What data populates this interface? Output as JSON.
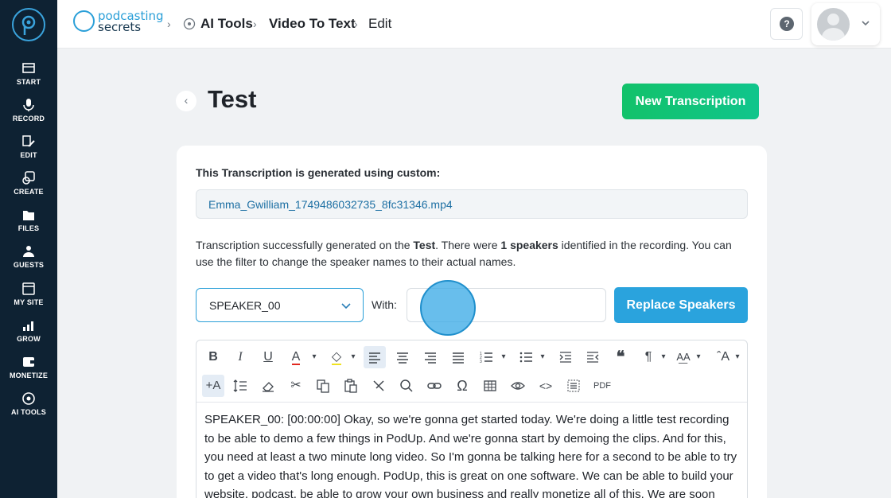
{
  "sidebar": {
    "items": [
      {
        "label": "START",
        "icon": "start-icon"
      },
      {
        "label": "RECORD",
        "icon": "microphone-icon"
      },
      {
        "label": "EDIT",
        "icon": "edit-icon"
      },
      {
        "label": "CREATE",
        "icon": "create-icon"
      },
      {
        "label": "FILES",
        "icon": "files-icon"
      },
      {
        "label": "GUESTS",
        "icon": "guests-icon"
      },
      {
        "label": "MY SITE",
        "icon": "site-icon"
      },
      {
        "label": "GROW",
        "icon": "chart-icon"
      },
      {
        "label": "MONETIZE",
        "icon": "monetize-icon"
      },
      {
        "label": "AI TOOLS",
        "icon": "ai-tools-icon"
      }
    ]
  },
  "brand": {
    "line1": "podcasting",
    "line2": "secrets"
  },
  "breadcrumb": [
    "AI Tools",
    "Video To Text",
    "Edit"
  ],
  "page": {
    "title": "Test",
    "new_button": "New Transcription"
  },
  "card": {
    "custom_label": "This Transcription is generated using custom:",
    "file_name": "Emma_Gwilliam_1749486032735_8fc31346.mp4",
    "desc_prefix": "Transcription successfully generated on the ",
    "desc_name": "Test",
    "desc_mid": ". There were ",
    "desc_speakers": "1 speakers",
    "desc_suffix": " identified in the recording. You can use the filter to change the speaker names to their actual names."
  },
  "speaker_filter": {
    "selected": "SPEAKER_00",
    "with_label": "With:",
    "with_value": "",
    "replace_button": "Replace Speakers"
  },
  "editor": {
    "pdf_label": "PDF",
    "content": "SPEAKER_00: [00:00:00] Okay, so we're gonna get started today. We're doing a little test recording to be able to demo a few things in PodUp. And we're gonna start by demoing the clips. And for this, you need at least a two minute long video. So I'm gonna be talking here for a second to be able to try to get a video that's long enough. PodUp, this is great on one software. We can be able to build your website, podcast, be able to grow your own business and really monetize all of this. We are soon going to be"
  },
  "colors": {
    "sidebar_bg": "#0e2233",
    "accent": "#2aa3dd",
    "new_button": "#12c26a"
  }
}
